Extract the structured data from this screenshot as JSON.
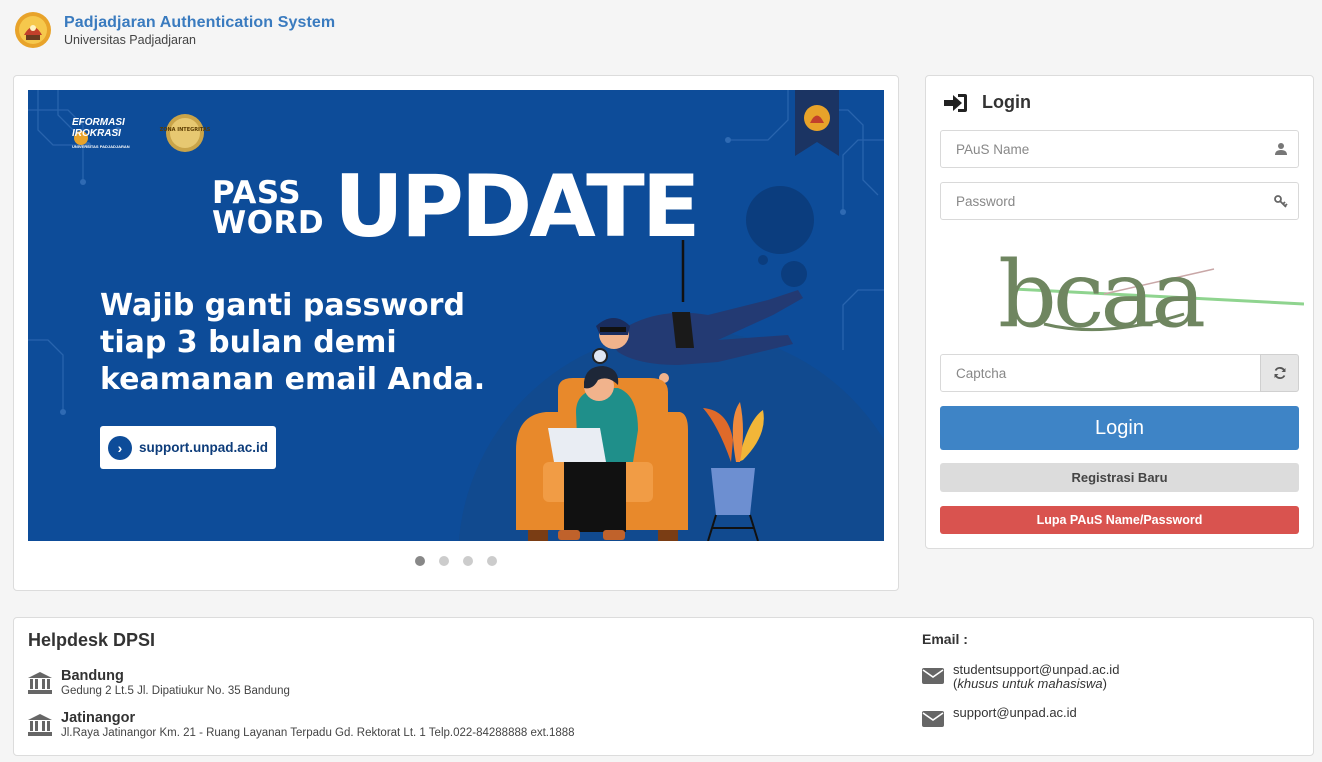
{
  "header": {
    "title": "Padjadjaran Authentication System",
    "subtitle": "Universitas Padjadjaran",
    "logo_icon": "university-seal-icon"
  },
  "banner": {
    "logo_text_1": "EFORMASI",
    "logo_text_2": "IROKRASI",
    "logo_text_3": "UNIVERSITAS PADJADJARAN",
    "badge_text": "ZONA INTEGRITAS",
    "headline_small_1": "PASS",
    "headline_small_2": "WORD",
    "headline_big": "UPDATE",
    "message": "Wajib ganti password tiap 3 bulan demi keamanan email Anda.",
    "link_text": "support.unpad.ac.id",
    "colors": {
      "background": "#0d4c99",
      "accent": "#e8892b"
    }
  },
  "carousel": {
    "total_slides": 4,
    "active_index": 0
  },
  "login": {
    "title": "Login",
    "username_placeholder": "PAuS Name",
    "password_placeholder": "Password",
    "captcha_text": "bcaa",
    "captcha_placeholder": "Captcha",
    "login_button": "Login",
    "register_button": "Registrasi Baru",
    "forgot_button": "Lupa PAuS Name/Password",
    "colors": {
      "primary": "#3e84c6",
      "danger": "#d9534f",
      "secondary": "#dcdcdc"
    }
  },
  "helpdesk": {
    "title": "Helpdesk DPSI",
    "locations": [
      {
        "name": "Bandung",
        "address": "Gedung 2 Lt.5 Jl. Dipatiukur No. 35 Bandung"
      },
      {
        "name": "Jatinangor",
        "address": "Jl.Raya Jatinangor Km. 21 - Ruang Layanan Terpadu Gd. Rektorat Lt. 1 Telp.022-84288888 ext.1888"
      }
    ],
    "email_label": "Email :",
    "emails": [
      {
        "address": "studentsupport@unpad.ac.id",
        "note": "khusus untuk mahasiswa"
      },
      {
        "address": "support@unpad.ac.id",
        "note": ""
      }
    ]
  }
}
